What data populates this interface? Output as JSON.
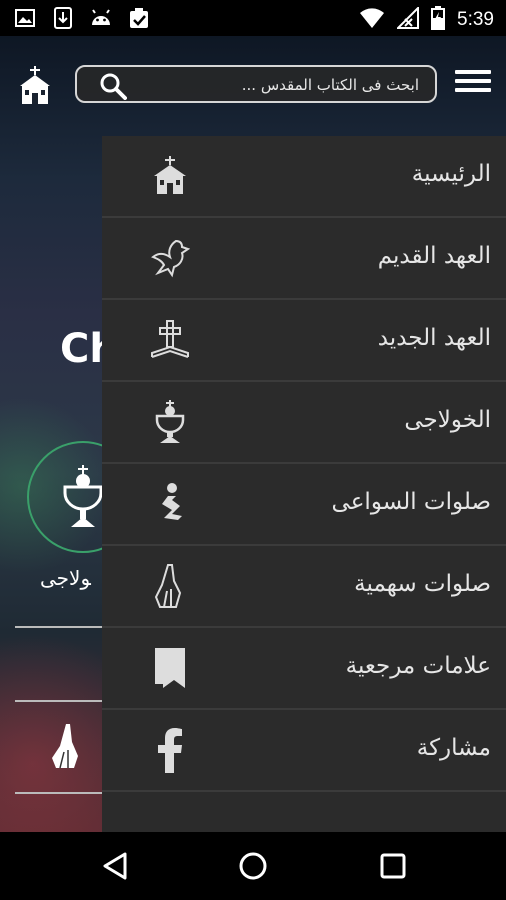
{
  "status_bar": {
    "time": "5:39",
    "left_icons": [
      "image-icon",
      "download-icon",
      "android-icon",
      "clipboard-check-icon"
    ],
    "right_icons": [
      "wifi-icon",
      "signal-icon",
      "battery-icon"
    ]
  },
  "header": {
    "search_placeholder": "ابحث فى الكتاب المقدس ..."
  },
  "background": {
    "title_fragment": "Ch",
    "card_label": "ﻮﻻﺟﻰ"
  },
  "drawer": {
    "items": [
      {
        "label": "الرئيسية",
        "icon": "church-icon"
      },
      {
        "label": "العهد القديم",
        "icon": "dove-icon"
      },
      {
        "label": "العهد الجديد",
        "icon": "cross-bible-icon"
      },
      {
        "label": "الخولاجى",
        "icon": "chalice-icon"
      },
      {
        "label": "صلوات السواعى",
        "icon": "kneeling-person-icon"
      },
      {
        "label": "صلوات سهمية",
        "icon": "praying-hands-icon"
      },
      {
        "label": "علامات مرجعية",
        "icon": "bookmark-icon"
      },
      {
        "label": "مشاركة",
        "icon": "facebook-icon"
      }
    ]
  },
  "nav_bar": {
    "buttons": [
      "back-icon",
      "home-icon",
      "recents-icon"
    ]
  }
}
